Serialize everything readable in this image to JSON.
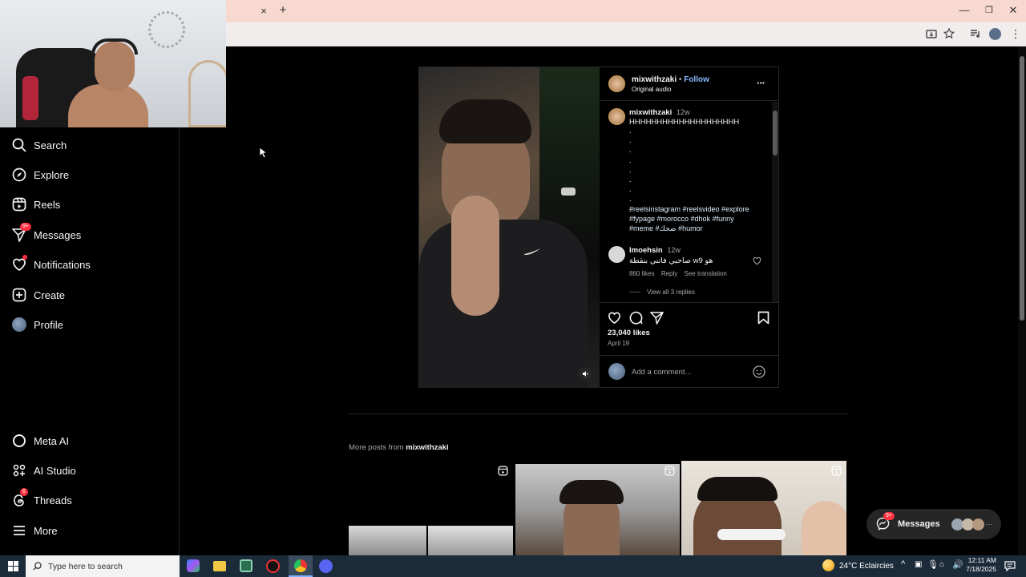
{
  "browser": {
    "tab_close": "×",
    "new_tab": "+",
    "window_min": "—",
    "window_max": "❐",
    "window_close": "✕"
  },
  "sidebar": {
    "items": [
      {
        "label": "Search",
        "icon": "search-icon"
      },
      {
        "label": "Explore",
        "icon": "compass-icon"
      },
      {
        "label": "Reels",
        "icon": "reels-icon"
      },
      {
        "label": "Messages",
        "icon": "send-icon",
        "badge": "9+"
      },
      {
        "label": "Notifications",
        "icon": "heart-icon"
      },
      {
        "label": "Create",
        "icon": "plus-square-icon"
      },
      {
        "label": "Profile",
        "icon": "avatar-icon"
      }
    ],
    "bottom_items": [
      {
        "label": "Meta AI",
        "icon": "meta-ai-icon"
      },
      {
        "label": "AI Studio",
        "icon": "ai-studio-icon"
      },
      {
        "label": "Threads",
        "icon": "threads-icon",
        "badge": "6"
      },
      {
        "label": "More",
        "icon": "menu-icon"
      }
    ]
  },
  "post": {
    "username": "mixwithzaki",
    "dot": "•",
    "follow": "Follow",
    "audio": "Original audio",
    "more": "···",
    "caption": {
      "username": "mixwithzaki",
      "time": "12w",
      "text": "HHHHHHHHHHHHHHHHHHHH",
      "dots": [
        ".",
        ".",
        ".",
        ".",
        ".",
        ".",
        ".",
        ".",
        "."
      ],
      "hashtags_line1": "#reelsinstagram #reelsvideo #explore",
      "hashtags_line2": "#fypage #morocco #dhok #funny",
      "hashtags_line3": "#meme #ضحك #humor"
    },
    "comment": {
      "username": "lmoehsin",
      "time": "12w",
      "text": "صاحبي فاتني بنقطة w9 هو",
      "likes": "860 likes",
      "reply": "Reply",
      "translate": "See translation",
      "view_replies": "View all 3 replies"
    },
    "likes": "23,040 likes",
    "date": "April 19",
    "add_comment_placeholder": "Add a comment..."
  },
  "more_posts": {
    "prefix": "More posts from ",
    "username": "mixwithzaki"
  },
  "messages_pill": {
    "label": "Messages",
    "badge": "9+",
    "more": "···"
  },
  "taskbar": {
    "search_placeholder": "Type here to search",
    "weather": "24°C  Eclaircies",
    "time": "12:11 AM",
    "date": "7/18/2025"
  },
  "colors": {
    "link_blue": "#e0f1ff",
    "follow_blue": "#8db9ff",
    "badge_red": "#ff3040",
    "tab_bg": "#f7d9cf"
  }
}
